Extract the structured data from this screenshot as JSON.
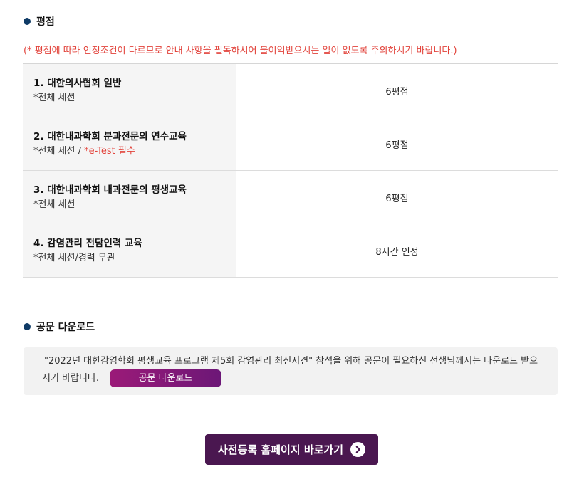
{
  "score_section": {
    "title": "평점",
    "notice": "(* 평점에 따라 인정조건이 다르므로 안내 사항을 필독하시어 불이익받으시는 일이 없도록 주의하시기 바랍니다.)",
    "rows": [
      {
        "title": "1. 대한의사협회 일반",
        "sub": "*전체 세션",
        "sub_red": "",
        "value": "6평점"
      },
      {
        "title": "2. 대한내과학회 분과전문의 연수교육",
        "sub": "*전체 세션 / ",
        "sub_red": "*e-Test 필수",
        "value": "6평점"
      },
      {
        "title": "3. 대한내과학회 내과전문의 평생교육",
        "sub": "*전체 세션",
        "sub_red": "",
        "value": "6평점"
      },
      {
        "title": "4. 감염관리 전담인력 교육",
        "sub": "*전체 세션/경력 무관",
        "sub_red": "",
        "value": "8시간 인정"
      }
    ]
  },
  "download_section": {
    "title": "공문 다운로드",
    "text_line1": "\"2022년 대한감염학회 평생교육 프로그램 제5회 감염관리 최신지견\" 참석을 위해 공문이 필요하신 선생님께서는 다운로드 받으",
    "text_line2": "시기 바랍니다.",
    "button_label": "공문 다운로드"
  },
  "main_button": {
    "label": "사전등록 홈페이지 바로가기",
    "icon": "chevron-right-circle-icon"
  },
  "colors": {
    "bullet": "#0f3b66",
    "notice": "#e2433b",
    "download_button": "#8a1a78",
    "main_button": "#4a1750"
  }
}
